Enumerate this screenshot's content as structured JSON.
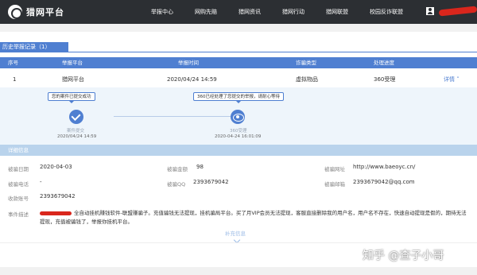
{
  "brand": {
    "logo_text": "猎网平台"
  },
  "nav": {
    "items": [
      "举报中心",
      "网购先赔",
      "猎网资讯",
      "猎网行动",
      "猎网联盟",
      "校园反诈联盟"
    ]
  },
  "history": {
    "tab_label": "历史举报记录（1）"
  },
  "table": {
    "headers": [
      "序号",
      "举报平台",
      "举报时间",
      "诈骗类型",
      "处理进度"
    ],
    "row": {
      "index": "1",
      "platform": "猎网平台",
      "time": "2020/04/24 14:59",
      "type": "虚拟物品",
      "status": "360受理",
      "detail_link": "详情"
    }
  },
  "progress": {
    "tip_submitted": "您的案件已提交成功",
    "tip_accepted": "360已经处理了您提交的举报，请耐心等待",
    "step1_label": "案件提交",
    "step1_date": "2020/04/24 14:59",
    "step2_label": "360受理",
    "step2_date": "2020-04-24 16:01:09"
  },
  "details": {
    "header": "详细信息",
    "date_label": "被骗日期",
    "date_value": "2020-04-03",
    "amount_label": "被骗金额",
    "amount_value": "98",
    "site_label": "被骗网址",
    "site_value": "http://www.baeoyc.cn/",
    "phone_label": "被骗电话",
    "phone_value": "-",
    "qq_label": "被骗QQ",
    "qq_value": "2393679042",
    "email_label": "被骗邮箱",
    "email_value": "2393679042@qq.com",
    "account_label": "收款账号",
    "account_value": "2393679042",
    "desc_label": "事件描述",
    "desc_value": "全自动挂机赚钱软件-联盟赚骗子。充值骗钱无法提现，挂机骗局平台。买了月VIP会员无法提现，客服直接删除我的用户名，用户名不存在，快速自动提现是假的，期待无法提现，充值被骗钱了，举报你挂机平台。",
    "more_label": "补充信息"
  },
  "watermark": "知乎 @查子小哥",
  "colors": {
    "accent": "#4f7fd1",
    "topbar": "#2c2f33",
    "redact": "#d9261c"
  }
}
